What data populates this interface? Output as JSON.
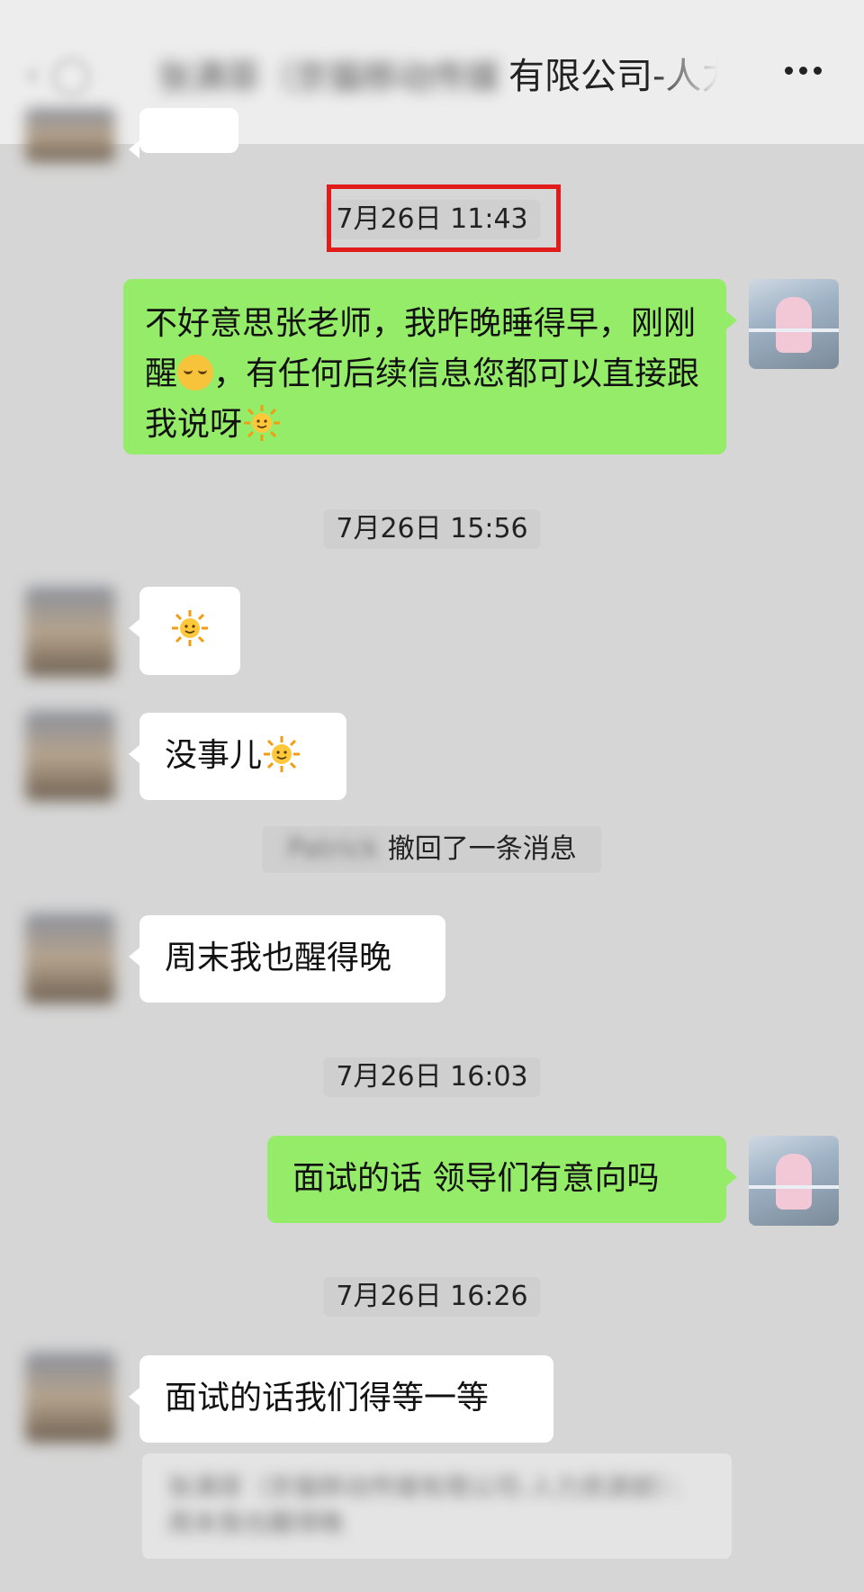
{
  "header": {
    "back_icon": "back-chevron-icon",
    "title_blurred": "张满菲（京猫移动传媒",
    "title_visible": "有限公司-人力",
    "more_icon": "more-dots-icon"
  },
  "messages": {
    "ts1": "7月26日 11:43",
    "out1_part1": "不好意思张老师，我昨晚睡得早，刚刚醒",
    "out1_part2": "，有任何后续信息您都可以直接跟我说呀",
    "ts2": "7月26日 15:56",
    "in2_part1": "没事儿",
    "recall_name": "Patrick",
    "recall_text": "撤回了一条消息",
    "in3": "周末我也醒得晚",
    "ts3": "7月26日 16:03",
    "out2": "面试的话 领导们有意向吗",
    "ts4": "7月26日 16:26",
    "in4": "面试的话我们得等一等",
    "quote_text": "张满菲（京猫移动传媒有限公司-人力资源部）：周末我也醒得晚"
  },
  "colors": {
    "background": "#d6d6d6",
    "header_bg": "#ededed",
    "bubble_out": "#95ec69",
    "bubble_in": "#ffffff",
    "highlight": "#e21b1b"
  }
}
